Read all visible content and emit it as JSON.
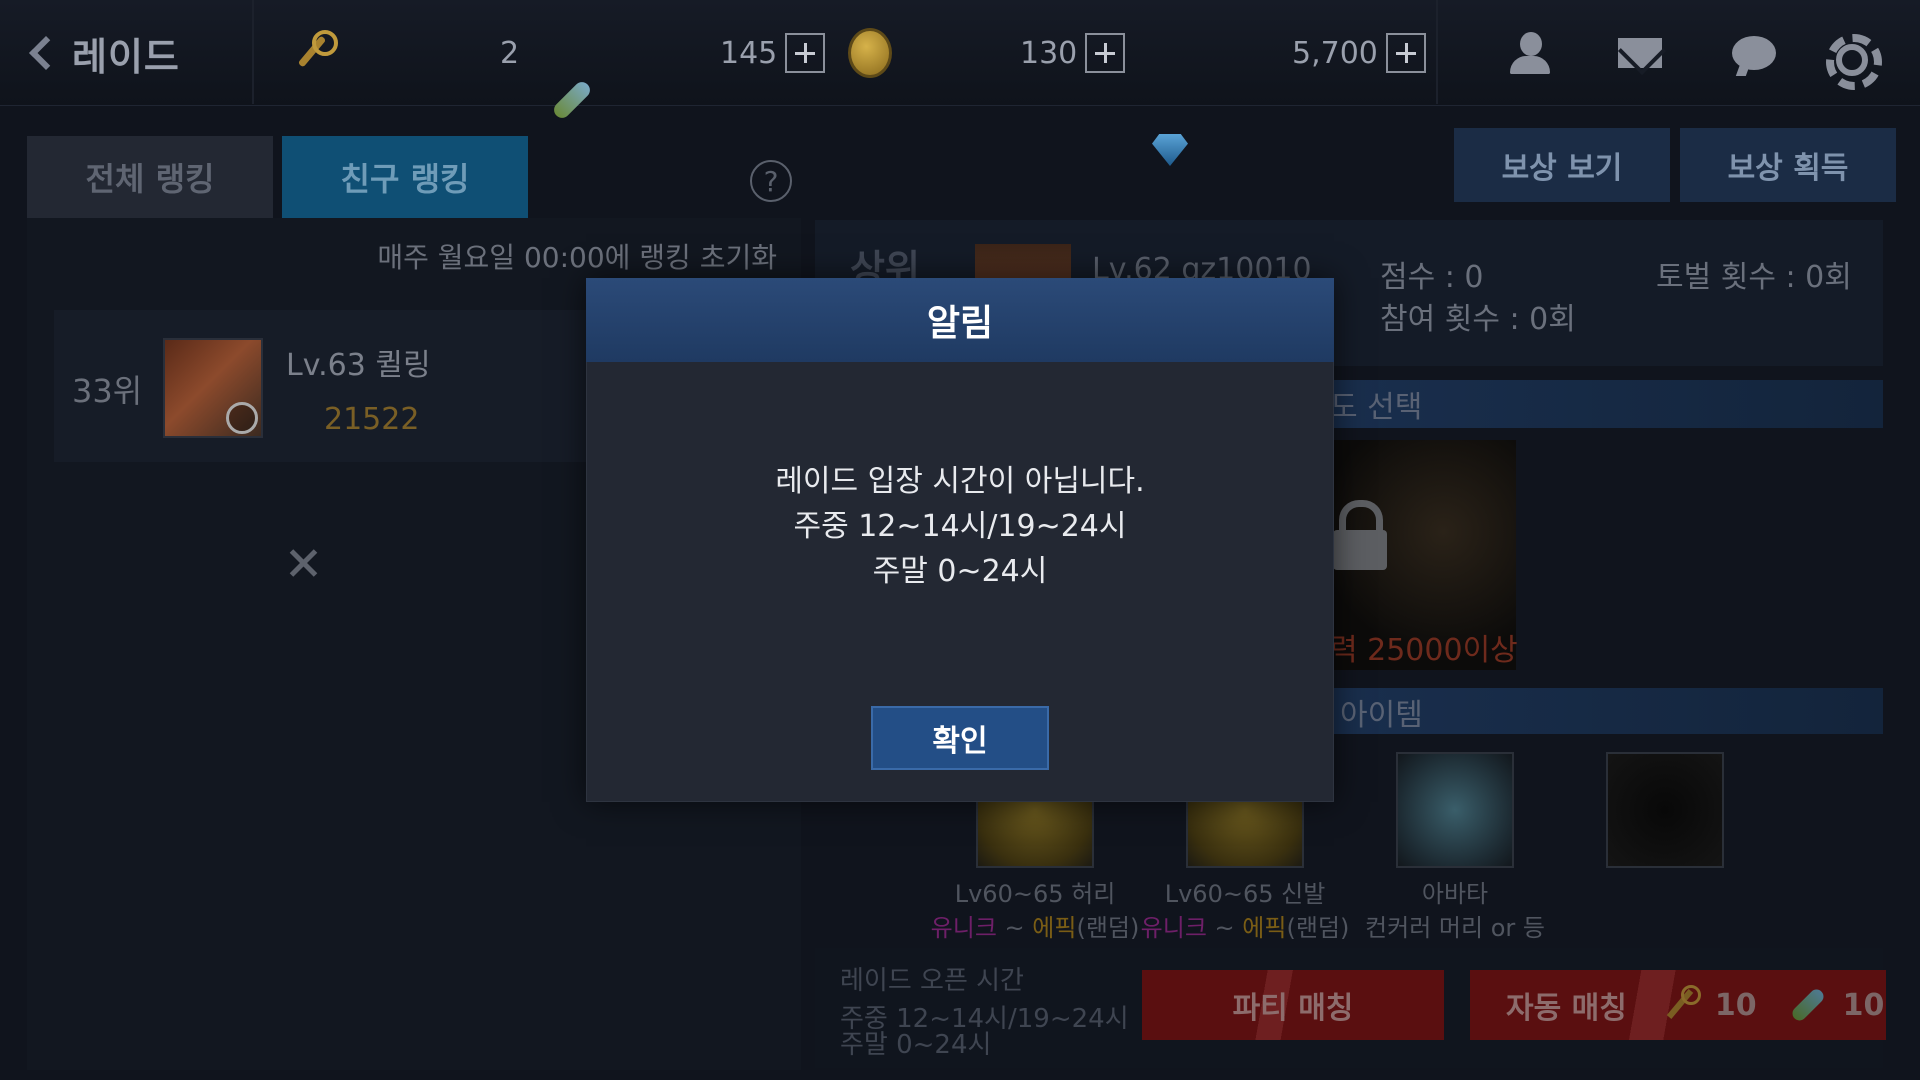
{
  "header": {
    "back_label": "레이드",
    "keys": "",
    "tickets": "2",
    "tickets_max": "145",
    "gold": "130",
    "gems": "5,700"
  },
  "tabs": {
    "all": "전체 랭킹",
    "friend": "친구 랭킹",
    "help": "?"
  },
  "top_buttons": {
    "view_reward": "보상 보기",
    "get_reward": "보상 획득"
  },
  "ranking": {
    "reset_note": "매주 월요일 00:00에 랭킹 초기화",
    "my_rank": "33위",
    "my_level": "Lv.63 퀼링",
    "my_power": "21522"
  },
  "raid_info": {
    "rank_label": "상위",
    "player": "Lv.62 gz10010",
    "score": "점수 : 0",
    "kills": "토벌 횟수 : 0회",
    "participation": "참여 횟수 : 0회"
  },
  "difficulty": {
    "label": "도 선택",
    "requirement": "력 25000이상"
  },
  "items": {
    "label": "아이템",
    "list": [
      {
        "name": "Lv60~65 허리",
        "grade_a": "유니크",
        "sep": " ~ ",
        "grade_b": "에픽",
        "suffix": "(랜덤)"
      },
      {
        "name": "Lv60~65 신발",
        "grade_a": "유니크",
        "sep": " ~ ",
        "grade_b": "에픽",
        "suffix": "(랜덤)"
      },
      {
        "name": "아바타",
        "grade_text": "컨커러 머리 or 등"
      }
    ]
  },
  "bottom": {
    "open_label": "레이드 오픈 시간",
    "open_weekday": "주중 12~14시/19~24시",
    "open_weekend": "주말 0~24시",
    "party_match": "파티 매칭",
    "auto_match": "자동 매칭",
    "cost_keys": "10",
    "cost_tickets": "10"
  },
  "modal": {
    "title": "알림",
    "line1": "레이드 입장 시간이 아닙니다.",
    "line2": "주중 12~14시/19~24시",
    "line3": "주말 0~24시",
    "ok": "확인"
  }
}
